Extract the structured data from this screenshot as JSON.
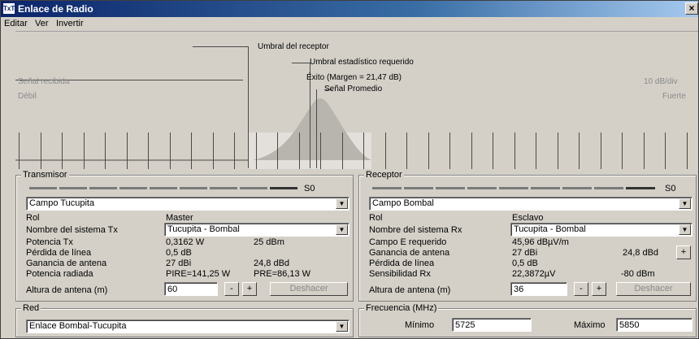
{
  "window": {
    "title": "Enlace de Radio",
    "icon_text": "TxT",
    "close": "×"
  },
  "menu": [
    "Editar",
    "Ver",
    "Invertir"
  ],
  "meter": {
    "umbral_receptor": "Umbral del receptor",
    "umbral_estadistico": "Umbral estadístico requerido",
    "exito": "Éxito (Margen = 21,47 dB)",
    "senal_promedio": "Señal Promedio",
    "senal_recibida": "Señal recibida",
    "escala": "10 dB/div",
    "debil": "Débil",
    "fuerte": "Fuerte"
  },
  "transmisor": {
    "title": "Transmisor",
    "level": "S0",
    "station": "Campo Tucupita",
    "rol_label": "Rol",
    "rol_value": "Master",
    "sistema_label": "Nombre del sistema Tx",
    "sistema_value": "Tucupita - Bombal",
    "potencia_label": "Potencia Tx",
    "potencia_w": "0,3162 W",
    "potencia_dbm": "25 dBm",
    "perdida_label": "Pérdida de línea",
    "perdida_value": "0,5 dB",
    "ganancia_label": "Ganancia de antena",
    "ganancia_dbi": "27 dBi",
    "ganancia_dbd": "24,8 dBd",
    "radiada_label": "Potencia radiada",
    "pire": "PIRE=141,25 W",
    "pre": "PRE=86,13 W",
    "altura_label": "Altura de antena (m)",
    "altura_value": "60",
    "minus": "-",
    "plus": "+",
    "deshacer": "Deshacer"
  },
  "receptor": {
    "title": "Receptor",
    "level": "S0",
    "station": "Campo Bombal",
    "rol_label": "Rol",
    "rol_value": "Esclavo",
    "sistema_label": "Nombre del sistema Rx",
    "sistema_value": "Tucupita - Bombal",
    "campo_label": "Campo E requerido",
    "campo_value": "45,96 dBµV/m",
    "ganancia_label": "Ganancia de antena",
    "ganancia_dbi": "27 dBi",
    "ganancia_dbd": "24,8 dBd",
    "ganancia_plus": "+",
    "perdida_label": "Pérdida de línea",
    "perdida_value": "0,5 dB",
    "sensibilidad_label": "Sensibilidad Rx",
    "sensibilidad_uv": "22,3872µV",
    "sensibilidad_dbm": "-80 dBm",
    "altura_label": "Altura de antena (m)",
    "altura_value": "36",
    "minus": "-",
    "plus": "+",
    "deshacer": "Deshacer"
  },
  "red": {
    "title": "Red",
    "value": "Enlace Bombal-Tucupita"
  },
  "frecuencia": {
    "title": "Frecuencia (MHz)",
    "min_label": "Mínimo",
    "min_value": "5725",
    "max_label": "Máximo",
    "max_value": "5850"
  }
}
